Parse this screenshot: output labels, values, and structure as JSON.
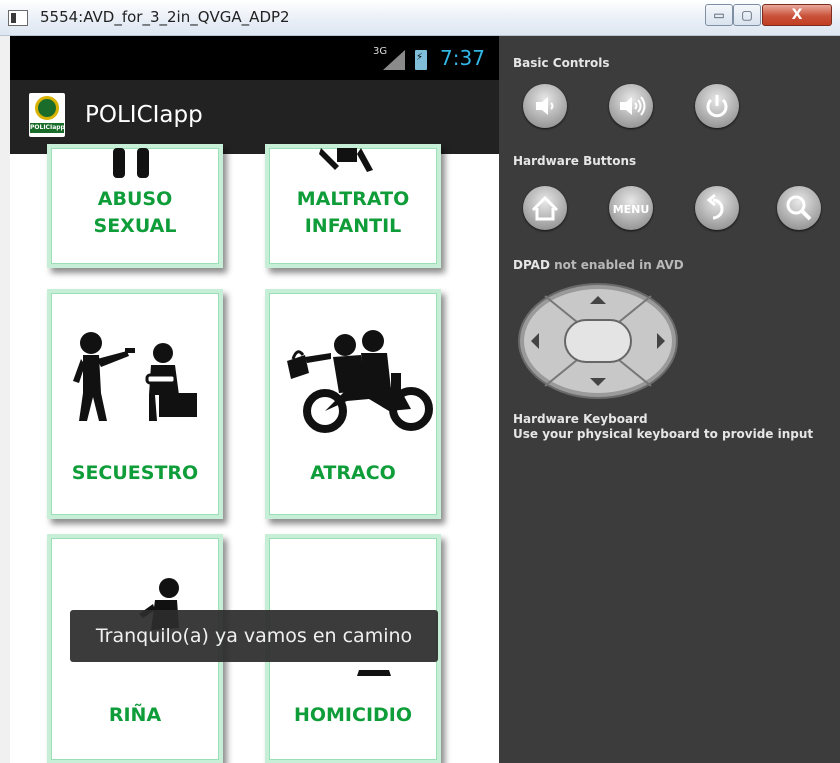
{
  "window": {
    "title": "5554:AVD_for_3_2in_QVGA_ADP2",
    "minimize_glyph": "▭",
    "maximize_glyph": "▢",
    "close_glyph": "X"
  },
  "status_bar": {
    "network_type": "3G",
    "time": "7:37",
    "clock_color": "#33b5e5"
  },
  "action_bar": {
    "app_title": "POLICIapp",
    "logo_text": "POLICIapp"
  },
  "tiles": [
    {
      "label": "ABUSO\nSEXUAL",
      "icon": "abuse-pictogram"
    },
    {
      "label": "MALTRATO\nINFANTIL",
      "icon": "child-abuse-pictogram"
    },
    {
      "label": "SECUESTRO",
      "icon": "kidnapping-pictogram"
    },
    {
      "label": "ATRACO",
      "icon": "robbery-motorcycle-pictogram"
    },
    {
      "label": "RIÑA",
      "icon": "fight-pictogram"
    },
    {
      "label": "HOMICIDIO",
      "icon": "homicide-pictogram"
    }
  ],
  "toast": {
    "message": "Tranquilo(a) ya vamos en camino"
  },
  "controls": {
    "basic_controls_title": "Basic Controls",
    "basic_buttons": [
      "volume-down-icon",
      "volume-up-icon",
      "power-icon"
    ],
    "hardware_buttons_title": "Hardware Buttons",
    "hardware_buttons": [
      "home-icon",
      "menu-button",
      "back-icon",
      "search-icon"
    ],
    "menu_label": "MENU",
    "dpad_title": "DPAD",
    "dpad_note": "not enabled in AVD",
    "keyboard_title": "Hardware Keyboard",
    "keyboard_note": "Use your physical keyboard to provide input"
  },
  "colors": {
    "tile_label": "#0f9d3a",
    "tile_border": "#c7eed6",
    "panel_bg": "#3c3c3c",
    "action_bar_bg": "#222222"
  }
}
